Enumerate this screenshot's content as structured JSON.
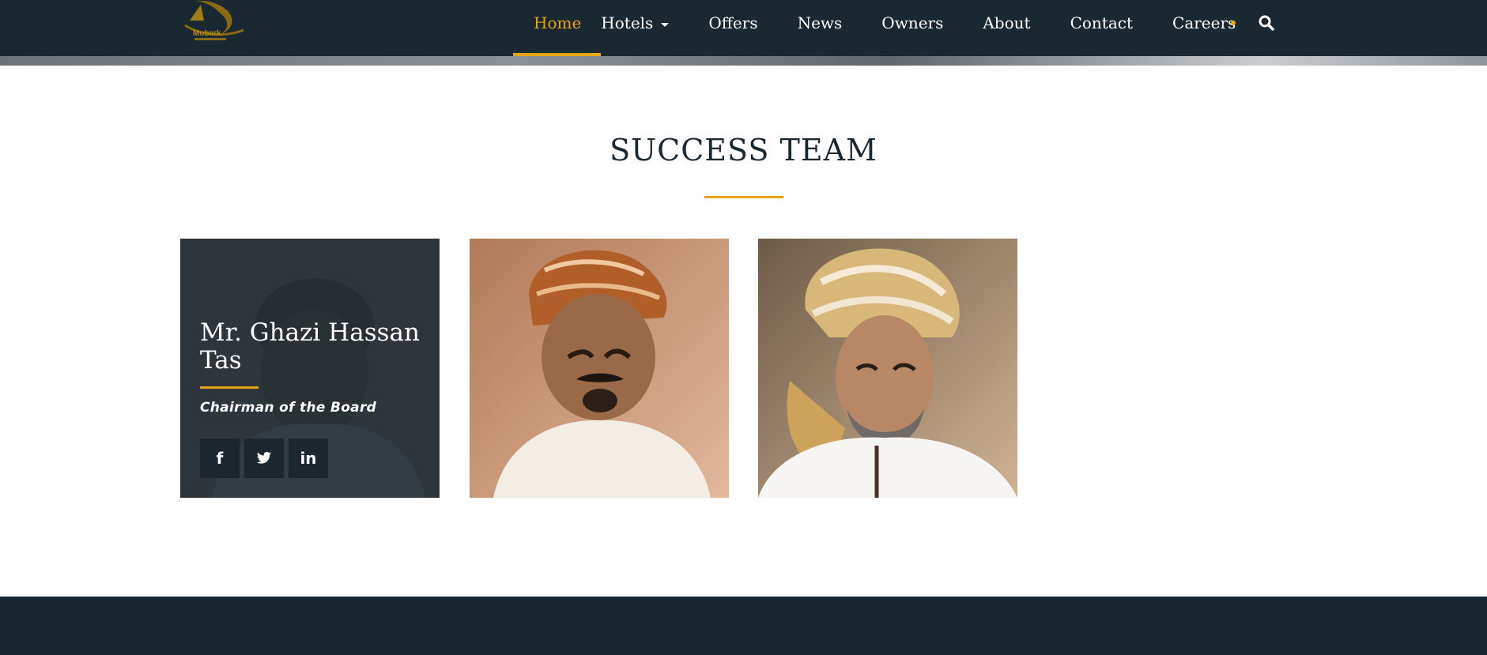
{
  "header": {
    "logo_text": "Mobark",
    "nav": [
      {
        "label": "Home",
        "active": true
      },
      {
        "label": "Hotels",
        "has_dropdown": true
      },
      {
        "label": "Offers"
      },
      {
        "label": "News"
      },
      {
        "label": "Owners"
      },
      {
        "label": "About"
      },
      {
        "label": "Contact"
      },
      {
        "label": "Careers"
      }
    ],
    "search_icon": "search-icon"
  },
  "section": {
    "title": "SUCCESS TEAM"
  },
  "team": [
    {
      "name": "Mr. Ghazi Hassan Tas",
      "role": "Chairman of the Board",
      "socials": [
        {
          "icon": "facebook-icon",
          "glyph": "f"
        },
        {
          "icon": "twitter-icon",
          "glyph": "🐦"
        },
        {
          "icon": "linkedin-icon",
          "glyph": "in"
        }
      ]
    },
    {
      "photo": "portrait-orange-turban"
    },
    {
      "photo": "portrait-gold-turban"
    }
  ],
  "colors": {
    "header_bg": "#1a2831",
    "accent": "#e8a512",
    "footer_bg": "#18262f",
    "overlay": "#1d2830"
  }
}
